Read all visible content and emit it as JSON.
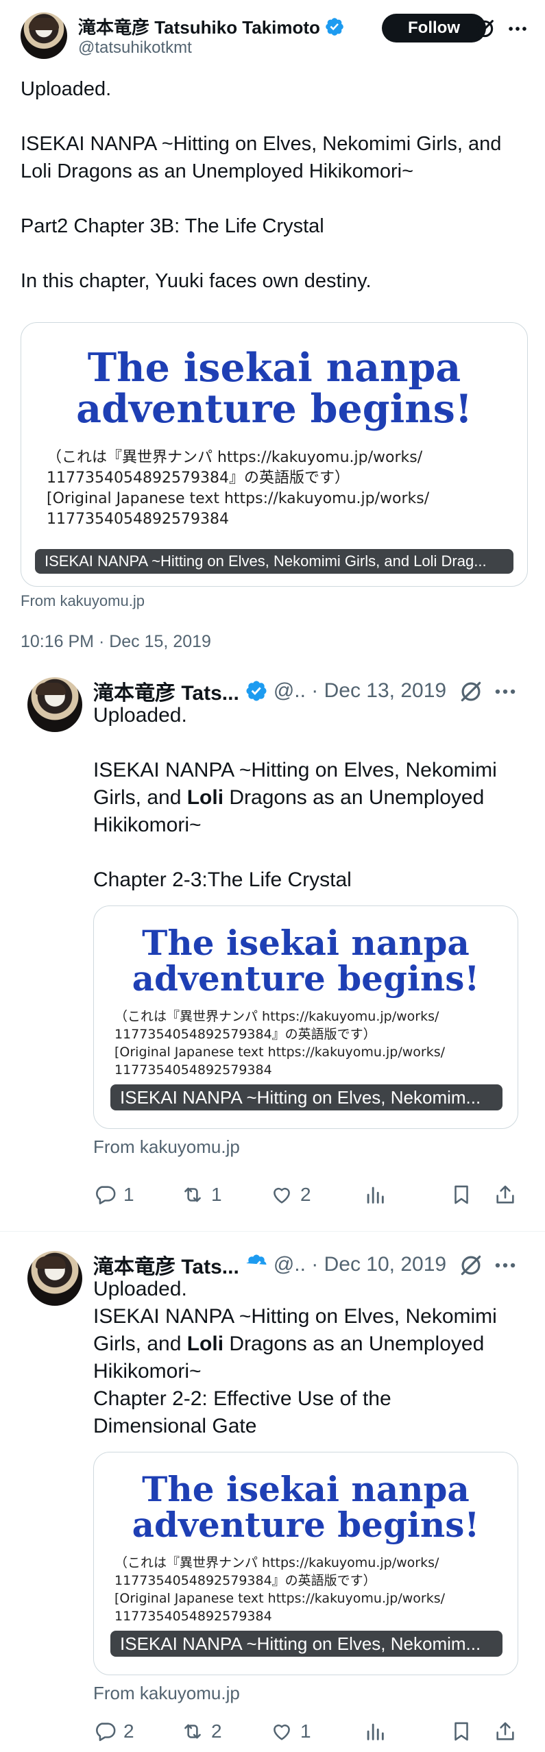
{
  "main_tweet": {
    "display_name": "滝本竜彦 Tatsuhiko Takimoto",
    "handle": "@tatsuhikotkmt",
    "follow_label": "Follow",
    "text": {
      "line1": "Uploaded.",
      "line2": "ISEKAI NANPA ~Hitting on Elves, Nekomimi Girls, and Loli Dragons as an Unemployed Hikikomori~",
      "line3": "Part2 Chapter 3B: The Life Crystal",
      "line4": "In this chapter, Yuuki faces own destiny."
    },
    "card": {
      "title_line1": "The isekai nanpa",
      "title_line2": "adventure begins!",
      "body_line1": "（これは『異世界ナンパ https://kakuyomu.jp/works/",
      "body_line2": "1177354054892579384』の英語版です）",
      "body_line3": "[Original Japanese text https://kakuyomu.jp/works/",
      "body_line4": "1177354054892579384",
      "overlay": "ISEKAI NANPA ~Hitting on Elves, Nekomimi Girls, and Loli Drag..."
    },
    "from": "From kakuyomu.jp",
    "timestamp": "10:16 PM · Dec 15, 2019"
  },
  "replies": [
    {
      "display_name": "滝本竜彦 Tats...",
      "meta": "@.. · Dec 13, 2019",
      "uploaded": "Uploaded.",
      "title_a": "ISEKAI NANPA ~Hitting on Elves, Nekomimi",
      "title_b": "Girls, and ",
      "title_bold": "Loli",
      "title_c": " Dragons as an Unemployed",
      "title_d": "Hikikomori~",
      "chapter": "Chapter 2-3:The Life Crystal",
      "card": {
        "title_line1": "The isekai nanpa",
        "title_line2": "adventure begins!",
        "body_line1": "（これは『異世界ナンパ https://kakuyomu.jp/works/",
        "body_line2": "1177354054892579384』の英語版です）",
        "body_line3": "[Original Japanese text https://kakuyomu.jp/works/",
        "body_line4": "1177354054892579384",
        "overlay": "ISEKAI NANPA ~Hitting on Elves, Nekomim..."
      },
      "from": "From kakuyomu.jp",
      "replies_count": "1",
      "reposts_count": "1",
      "likes_count": "2"
    },
    {
      "display_name": "滝本竜彦 Tats...",
      "meta": "@.. · Dec 10, 2019",
      "uploaded": "Uploaded.",
      "title_a": "ISEKAI NANPA ~Hitting on Elves, Nekomimi",
      "title_b": "Girls, and ",
      "title_bold": "Loli",
      "title_c": " Dragons as an Unemployed",
      "title_d": "Hikikomori~",
      "chapter_line1": "Chapter 2-2: Effective Use of the",
      "chapter_line2": "Dimensional Gate",
      "card": {
        "title_line1": "The isekai nanpa",
        "title_line2": "adventure begins!",
        "body_line1": "（これは『異世界ナンパ https://kakuyomu.jp/works/",
        "body_line2": "1177354054892579384』の英語版です）",
        "body_line3": "[Original Japanese text https://kakuyomu.jp/works/",
        "body_line4": "1177354054892579384",
        "overlay": "ISEKAI NANPA ~Hitting on Elves, Nekomim..."
      },
      "from": "From kakuyomu.jp",
      "replies_count": "2",
      "reposts_count": "2",
      "likes_count": "1"
    }
  ],
  "colors": {
    "accent_verified": "#1d9bf0",
    "card_title": "#1e3fb4",
    "secondary_text": "#536471"
  },
  "icons": [
    "verified-badge-icon",
    "grok-icon",
    "more-icon",
    "reply-icon",
    "repost-icon",
    "like-icon",
    "views-icon",
    "bookmark-icon",
    "share-icon"
  ]
}
